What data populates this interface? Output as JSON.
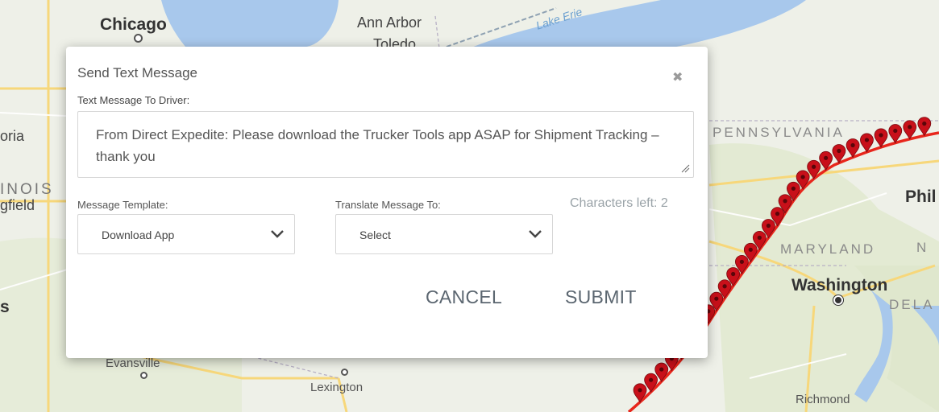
{
  "map": {
    "labels": {
      "chicago": "Chicago",
      "ann_arbor": "Ann Arbor",
      "toledo": "Toledo",
      "lake_erie": "Lake Erie",
      "peoria": "oria",
      "illinois": "INOIS",
      "springfield": "gfield",
      "pennsylvania": "PENNSYLVANIA",
      "philadelphia": "Phil",
      "maryland": "MARYLAND",
      "nj": "N",
      "washington": "Washington",
      "delaware": "DELA",
      "evansville": "Evansville",
      "lexington": "Lexington",
      "richmond": "Richmond",
      "left_edge": "s"
    },
    "route_color": "#e8261c",
    "marker_color": "#c8101a"
  },
  "dialog": {
    "title": "Send Text Message",
    "close_icon": "close-icon",
    "message_label": "Text Message To Driver:",
    "message_text": "From Direct Expedite: Please download the Trucker Tools app ASAP for Shipment Tracking – thank you",
    "characters_left": "Characters left: 2",
    "template_label": "Message Template:",
    "template_value": "Download App",
    "translate_label": "Translate Message To:",
    "translate_value": "Select",
    "cancel_label": "CANCEL",
    "submit_label": "SUBMIT"
  }
}
